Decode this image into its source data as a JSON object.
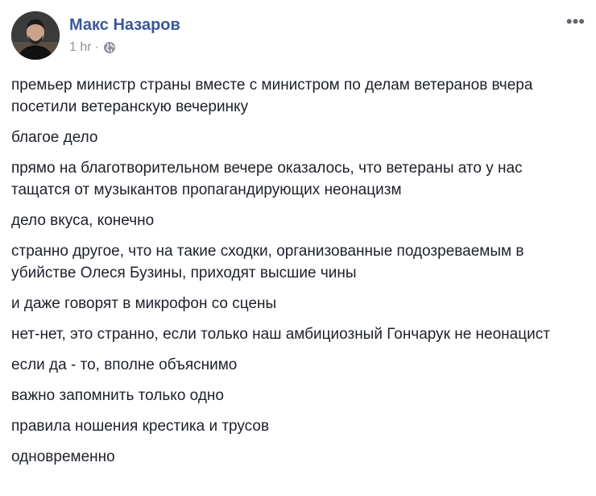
{
  "post": {
    "author": "Макс Назаров",
    "time": "1 hr",
    "separator": "·",
    "privacy_icon": "globe-icon",
    "more_icon": "more-options-icon",
    "more_label": "•••",
    "paragraphs": [
      "премьер министр страны вместе с министром по делам ветеранов вчера посетили ветеранскую вечеринку",
      "благое дело",
      "прямо на благотворительном вечере оказалось, что ветераны ато у нас тащатся от музыкантов пропагандирующих неонацизм",
      "дело вкуса, конечно",
      "странно другое, что на такие сходки, организованные подозреваемым в убийстве Олеся Бузины, приходят высшие чины",
      "и даже говорят в микрофон со сцены",
      "нет-нет, это странно, если только наш амбициозный Гончарук не неонацист",
      "если да - то, вполне объяснимо",
      "важно запомнить только одно",
      "правила ношения крестика и трусов",
      "одновременно"
    ]
  },
  "colors": {
    "author": "#385898",
    "meta": "#90949c",
    "text": "#1d2129"
  }
}
